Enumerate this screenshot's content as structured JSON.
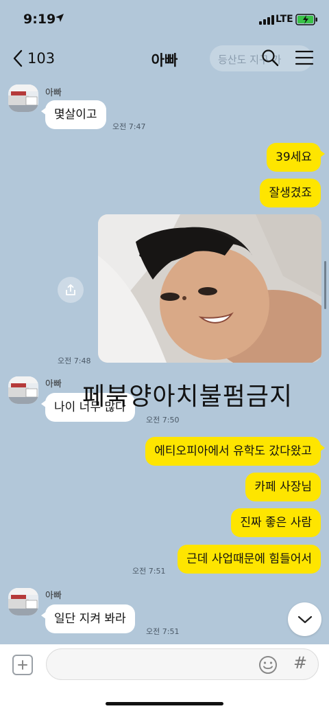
{
  "status_bar": {
    "time": "9:19",
    "network": "LTE"
  },
  "header": {
    "back_count": "103",
    "title": "아빠",
    "ghost_search": "등산도 지구 가"
  },
  "messages": {
    "m1": {
      "sender": "아빠",
      "text": "몇살이고",
      "time": "오전 7:47"
    },
    "m2": {
      "text": "39세요"
    },
    "m3": {
      "text": "잘생겼죠"
    },
    "m4": {
      "time": "오전 7:48"
    },
    "m5": {
      "sender": "아빠",
      "text": "나이 너무 많다",
      "time": "오전 7:50"
    },
    "m6": {
      "text": "에티오피아에서 유학도 갔다왔고"
    },
    "m7": {
      "text": "카페 사장님"
    },
    "m8": {
      "text": "진짜 좋은 사람"
    },
    "m9": {
      "text": "근데 사업때문에 힘들어서",
      "time": "오전 7:51"
    },
    "m10": {
      "sender": "아빠",
      "text": "일단 지켜 봐라",
      "time": "오전 7:51"
    }
  },
  "watermark": "페북양아치불펌금지",
  "input": {
    "value": ""
  },
  "colors": {
    "background": "#b2c7d9",
    "my_bubble": "#fee500",
    "their_bubble": "#ffffff"
  }
}
